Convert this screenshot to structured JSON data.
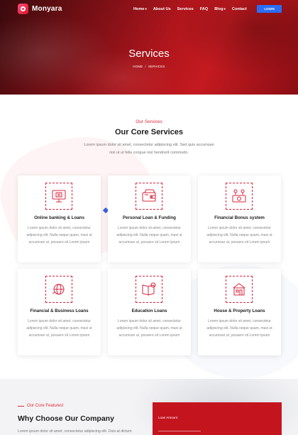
{
  "brand": {
    "name": "Monyara"
  },
  "nav": {
    "items": [
      {
        "label": "Home",
        "dropdown": true
      },
      {
        "label": "About Us",
        "dropdown": false
      },
      {
        "label": "Services",
        "dropdown": false
      },
      {
        "label": "FAQ",
        "dropdown": false
      },
      {
        "label": "Blog",
        "dropdown": true
      },
      {
        "label": "Contact",
        "dropdown": false
      }
    ],
    "caret": "▾",
    "login_label": "LOGIN"
  },
  "hero": {
    "title": "Services",
    "breadcrumb": [
      "HOME",
      "SERVICES"
    ],
    "separator": "/"
  },
  "services": {
    "eyebrow": "Our Services",
    "title": "Our Core Services",
    "description": "Lorem ipsum dolor sit amet, consectetur adipiscing elit. Sed quis accumsan nisl ut ut felis congue nisl hendrerit commodo.",
    "cards": [
      {
        "title": "Online banking & Loans",
        "icon": "online-banking-icon",
        "text": "Lorem ipsum dolor sit amet, consectetur adipiscing elit. Nulla neque quam, maxi ut accumsan ut, posuere sit Lorem ipsum"
      },
      {
        "title": "Personal Loan & Funding",
        "icon": "personal-loan-icon",
        "text": "Lorem ipsum dolor sit amet, consectetur adipiscing elit. Nulla neque quam, maxi ut accumsan ut, posuere sit Lorem ipsum"
      },
      {
        "title": "Financial Bonus system",
        "icon": "bonus-system-icon",
        "text": "Lorem ipsum dolor sit amet, consectetur adipiscing elit. Nulla neque quam, maxi ut accumsan ut, posuere sit Lorem ipsum"
      },
      {
        "title": "Financial & Business Loans",
        "icon": "business-loan-icon",
        "text": "Lorem ipsum dolor sit amet, consectetur adipiscing elit. Nulla neque quam, maxi ut accumsan ut, posuere sit Lorem ipsum"
      },
      {
        "title": "Education Loans",
        "icon": "education-loan-icon",
        "text": "Lorem ipsum dolor sit amet, consectetur adipiscing elit. Nulla neque quam, maxi ut accumsan ut, posuere sit Lorem ipsum"
      },
      {
        "title": "House & Property Loans",
        "icon": "house-loan-icon",
        "text": "Lorem ipsum dolor sit amet, consectetur adipiscing elit. Nulla neque quam, maxi ut accumsan ut, posuere sit Lorem ipsum"
      }
    ]
  },
  "why": {
    "eyebrow": "Our Core Features!",
    "title": "Why Choose Our Company",
    "description": "Lorem ipsum dolor sit amet, consectetur adipiscing elit. Duis at dictum",
    "loan_label": "Loan Amount"
  },
  "colors": {
    "accent": "#e0283a",
    "button": "#2b6df6",
    "panel": "#c4151f"
  }
}
